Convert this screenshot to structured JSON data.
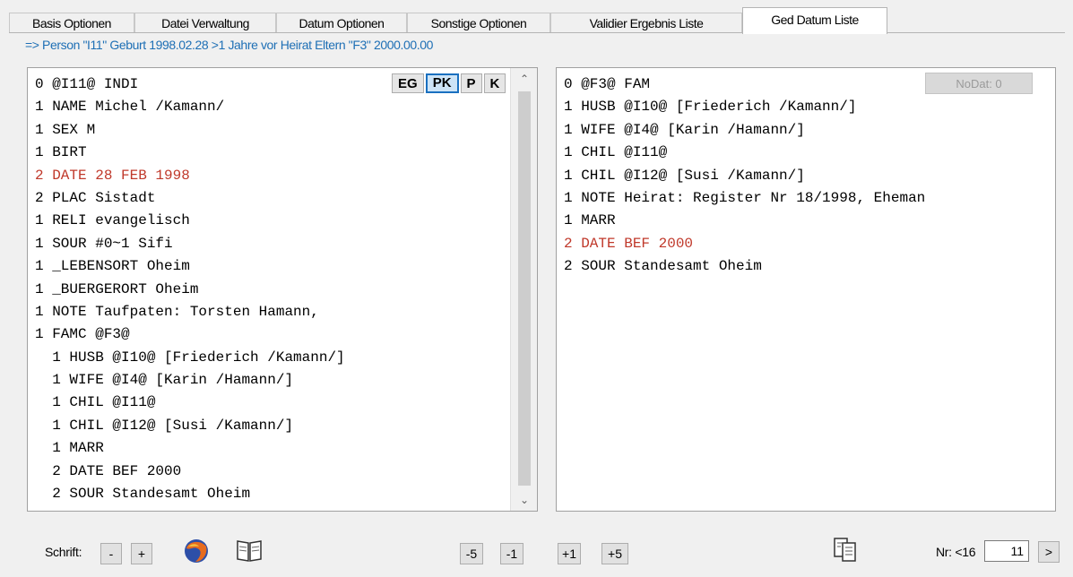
{
  "tabs": [
    {
      "label": "Basis Optionen"
    },
    {
      "label": "Datei Verwaltung"
    },
    {
      "label": "Datum Optionen"
    },
    {
      "label": "Sonstige Optionen"
    },
    {
      "label": "Validier Ergebnis Liste"
    },
    {
      "label": "Ged Datum Liste"
    }
  ],
  "status_text": "=> Person \"I11\" Geburt 1998.02.28 >1 Jahre vor Heirat Eltern \"F3\" 2000.00.00",
  "left_panel": {
    "mode_buttons": [
      "EG",
      "PK",
      "P",
      "K"
    ],
    "active_mode": "PK",
    "lines": [
      "0 @I11@ INDI",
      "1 NAME Michel /Kamann/",
      "1 SEX M",
      "1 BIRT",
      "2 DATE 28 FEB 1998",
      "2 PLAC Sistadt",
      "1 RELI evangelisch",
      "1 SOUR #0~1 Sifi",
      "1 _LEBENSORT Oheim",
      "1 _BUERGERORT Oheim",
      "1 NOTE Taufpaten: Torsten Hamann,",
      "1 FAMC @F3@",
      "  1 HUSB @I10@ [Friederich /Kamann/]",
      "  1 WIFE @I4@ [Karin /Hamann/]",
      "  1 CHIL @I11@",
      "  1 CHIL @I12@ [Susi /Kamann/]",
      "  1 MARR",
      "  2 DATE BEF 2000",
      "  2 SOUR Standesamt Oheim"
    ],
    "highlight_line_index": 4,
    "highlight_color": "#c0392b"
  },
  "right_panel": {
    "nodat_label": "NoDat: 0",
    "lines": [
      "0 @F3@ FAM",
      "1 HUSB @I10@ [Friederich /Kamann/]",
      "1 WIFE @I4@ [Karin /Hamann/]",
      "1 CHIL @I11@",
      "1 CHIL @I12@ [Susi /Kamann/]",
      "1 NOTE Heirat: Register Nr 18/1998, Eheman",
      "1 MARR",
      "2 DATE BEF 2000",
      "2 SOUR Standesamt Oheim"
    ],
    "highlight_line_index": 7
  },
  "bottom": {
    "schrift_label": "Schrift:",
    "font_minus": "-",
    "font_plus": "+",
    "nav_buttons": [
      "-5",
      "-1",
      "+1",
      "+5"
    ],
    "nr_label": "Nr: <16",
    "nr_value": "11",
    "next_label": ">"
  },
  "icons": {
    "firefox": "firefox-icon",
    "book": "book-icon",
    "copy": "copy-document-icon"
  }
}
